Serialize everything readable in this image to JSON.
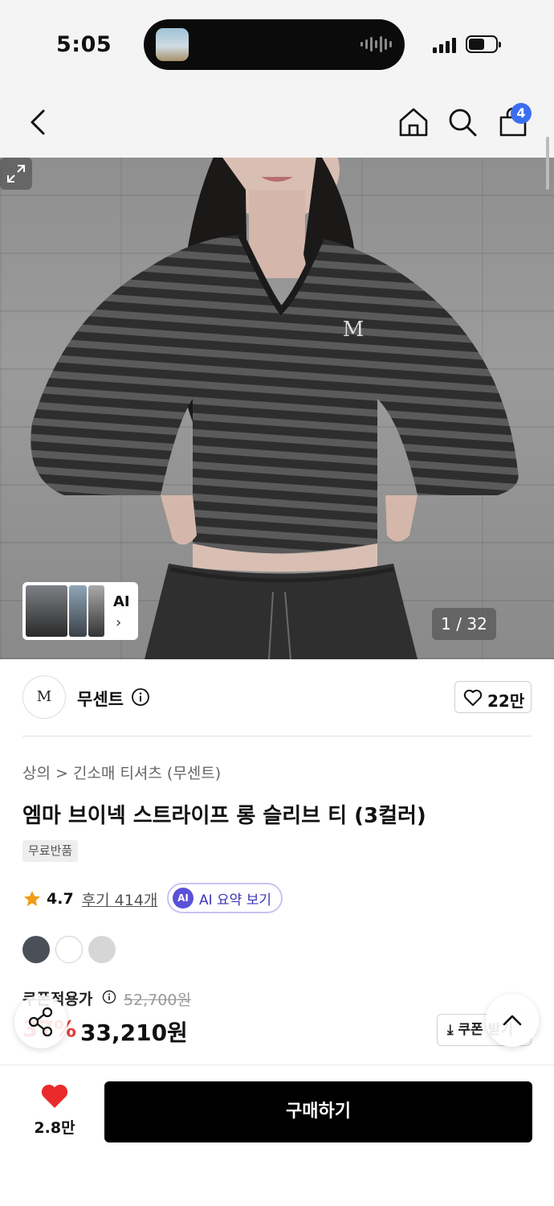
{
  "status_bar": {
    "time": "5:05",
    "battery_level": 0.6
  },
  "nav": {
    "cart_count": "4",
    "icons": [
      "back-icon",
      "home-icon",
      "search-icon",
      "cart-icon"
    ]
  },
  "gallery": {
    "ai_chip_label": "AI",
    "counter": "1 / 32",
    "logo_mark": "M"
  },
  "brand": {
    "logo_text": "M",
    "name": "무센트",
    "like_count": "22만"
  },
  "product": {
    "breadcrumb": "상의 > 긴소매 티셔츠 (무센트)",
    "title": "엠마 브이넥 스트라이프 롱 슬리브 티 (3컬러)",
    "tag": "무료반품",
    "rating": "4.7",
    "reviews": "후기 414개",
    "ai_summary_badge": "AI",
    "ai_summary_label": "AI 요약 보기",
    "colors": [
      "#4b4f58",
      "#ffffff",
      "#d6d6d6"
    ]
  },
  "price": {
    "coupon_label": "쿠폰적용가",
    "original": "52,700원",
    "discount": "37%",
    "sale": "33,210원",
    "coupon_button": "쿠폰 받기"
  },
  "bottom_bar": {
    "wish_count": "2.8만",
    "buy_label": "구매하기"
  }
}
